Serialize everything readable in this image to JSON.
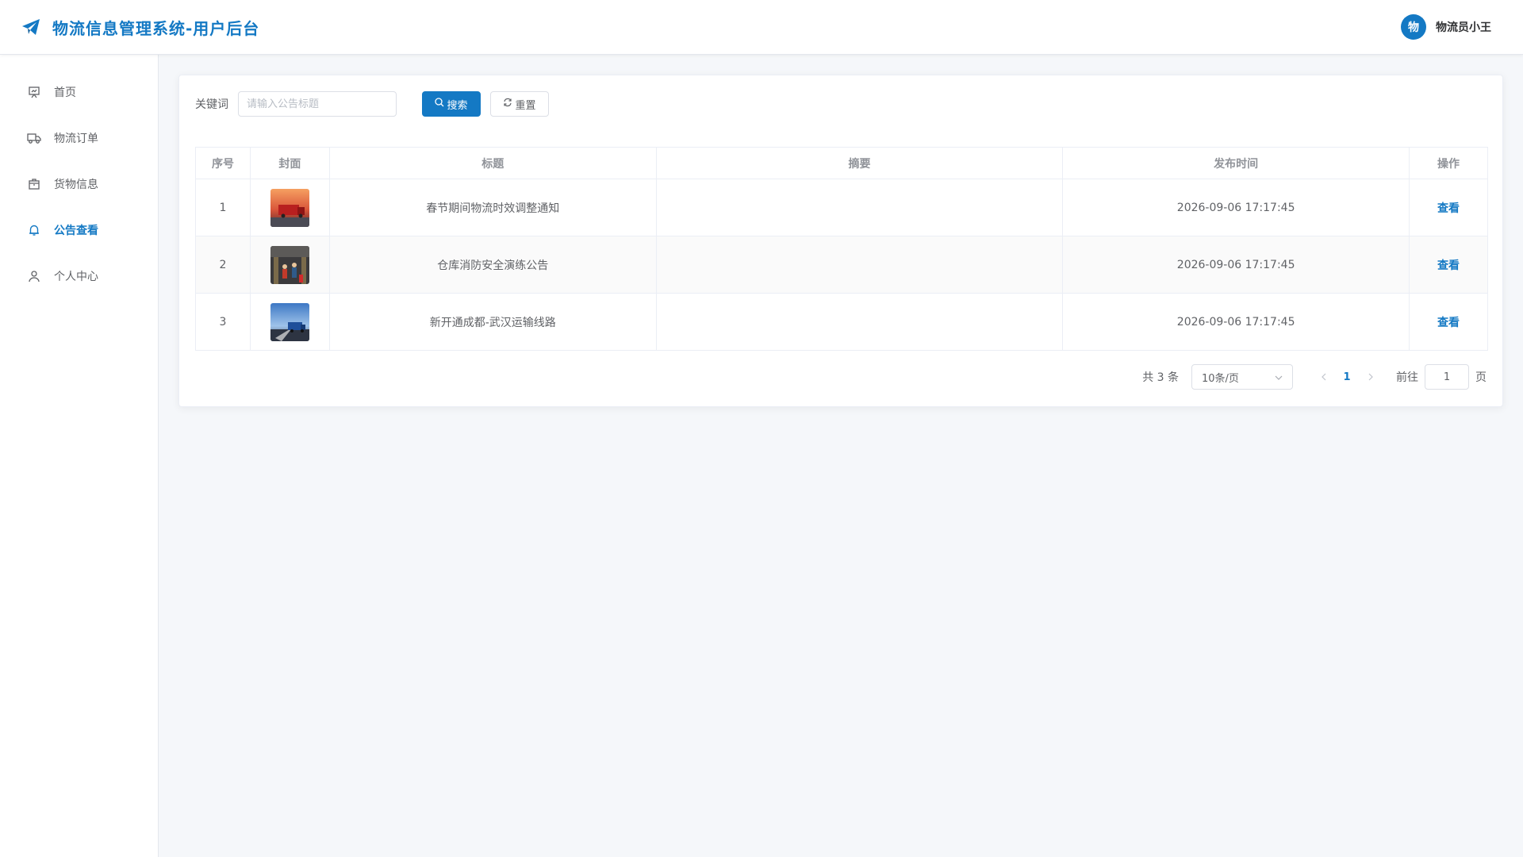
{
  "header": {
    "title": "物流信息管理系统-用户后台",
    "avatar_text": "物",
    "user_name": "物流员小王",
    "brand_color": "#1479c4"
  },
  "sidebar": {
    "items": [
      {
        "label": "首页",
        "icon": "presentation-board-icon",
        "active": false
      },
      {
        "label": "物流订单",
        "icon": "truck-icon",
        "active": false
      },
      {
        "label": "货物信息",
        "icon": "package-box-icon",
        "active": false
      },
      {
        "label": "公告查看",
        "icon": "bell-icon",
        "active": true
      },
      {
        "label": "个人中心",
        "icon": "user-icon",
        "active": false
      }
    ]
  },
  "search": {
    "label": "关键词",
    "placeholder": "请输入公告标题",
    "value": "",
    "search_label": "搜索",
    "reset_label": "重置"
  },
  "table": {
    "headers": [
      "序号",
      "封面",
      "标题",
      "摘要",
      "发布时间",
      "操作"
    ],
    "rows": [
      {
        "index": "1",
        "cover": "red-truck-sunset-photo",
        "title": "春节期间物流时效调整通知",
        "summary": "",
        "time": "2026-09-06 17:17:45",
        "action": "查看"
      },
      {
        "index": "2",
        "cover": "warehouse-fire-drill-photo",
        "title": "仓库消防安全演练公告",
        "summary": "",
        "time": "2026-09-06 17:17:45",
        "action": "查看"
      },
      {
        "index": "3",
        "cover": "blue-truck-highway-photo",
        "title": "新开通成都-武汉运输线路",
        "summary": "",
        "time": "2026-09-06 17:17:45",
        "action": "查看"
      }
    ]
  },
  "pagination": {
    "total": "共 3 条",
    "page_size": "10条/页",
    "current_page": "1",
    "goto_label": "前往",
    "goto_value": "1",
    "goto_suffix": "页"
  }
}
